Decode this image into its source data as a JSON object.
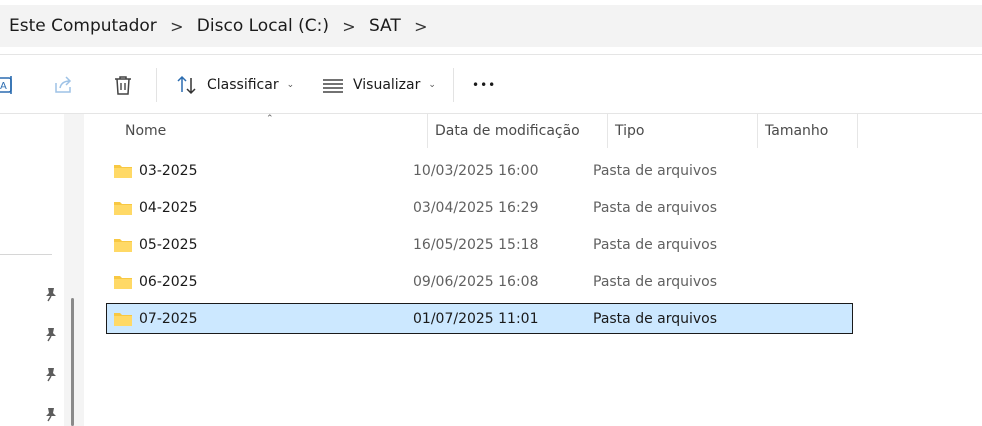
{
  "breadcrumb": {
    "items": [
      "Este Computador",
      "Disco Local (C:)",
      "SAT"
    ],
    "separator": ">"
  },
  "toolbar": {
    "sort_label": "Classificar",
    "view_label": "Visualizar",
    "more_label": "•••",
    "icons": [
      "rename-icon",
      "share-icon",
      "delete-icon",
      "sort-icon",
      "view-icon",
      "more-icon"
    ]
  },
  "columns": {
    "name": "Nome",
    "date": "Data de modificação",
    "type": "Tipo",
    "size": "Tamanho"
  },
  "files": [
    {
      "name": "03-2025",
      "date": "10/03/2025 16:00",
      "type": "Pasta de arquivos",
      "size": ""
    },
    {
      "name": "04-2025",
      "date": "03/04/2025 16:29",
      "type": "Pasta de arquivos",
      "size": ""
    },
    {
      "name": "05-2025",
      "date": "16/05/2025 15:18",
      "type": "Pasta de arquivos",
      "size": ""
    },
    {
      "name": "06-2025",
      "date": "09/06/2025 16:08",
      "type": "Pasta de arquivos",
      "size": ""
    },
    {
      "name": "07-2025",
      "date": "01/07/2025 11:01",
      "type": "Pasta de arquivos",
      "size": "",
      "selected": true
    }
  ],
  "colors": {
    "selection": "#cce8ff",
    "folder": "#f8c842",
    "accent": "#0067c0"
  }
}
